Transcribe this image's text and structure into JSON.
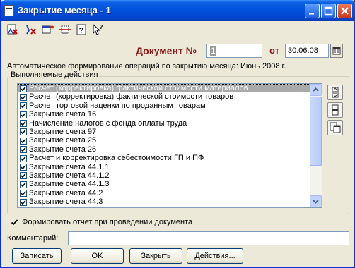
{
  "window": {
    "title": "Закрытие месяца - 1"
  },
  "toolbar": {
    "tools": [
      "delete-doc-icon",
      "delete-icon",
      "add-row-icon",
      "insert-icon",
      "help-icon",
      "pointer-help-icon"
    ]
  },
  "document": {
    "label": "Документ №",
    "number": "1",
    "date_label": "от",
    "date": "30.06.08"
  },
  "info": "Автоматическое формирование операций по закрытию месяца: Июнь 2008 г.",
  "actions": {
    "group_label": "Выполняемые действия",
    "items": [
      "Расчет (корректировка) фактической стоимости материалов",
      "Расчет (корректировка) фактической стоимости товаров",
      "Расчет торговой наценки по проданным товарам",
      "Закрытие счета 16",
      "Начисление налогов с фонда оплаты труда",
      "Закрытие счета 97",
      "Закрытие счета 25",
      "Закрытие счета 26",
      "Расчет и корректировка себестоимости ГП и ПФ",
      "Закрытие счета 44.1.1",
      "Закрытие счета 44.1.2",
      "Закрытие счета 44.1.3",
      "Закрытие счета 44.2",
      "Закрытие счета 44.3"
    ],
    "selected_index": 0
  },
  "report": {
    "label": "Формировать отчет при проведении документа",
    "checked": true
  },
  "comment": {
    "label": "Комментарий:",
    "value": ""
  },
  "buttons": {
    "save": "Записать",
    "ok": "OK",
    "close": "Закрыть",
    "actions": "Действия..."
  }
}
